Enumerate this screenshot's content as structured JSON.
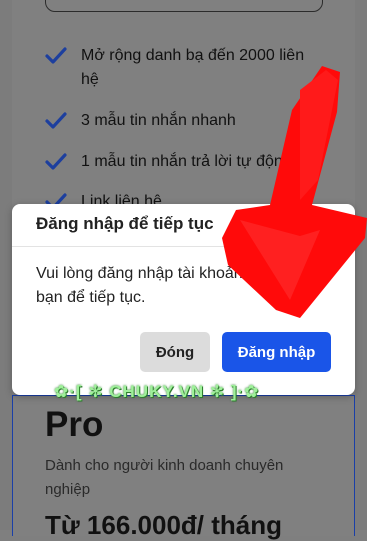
{
  "features": [
    {
      "label": "Mở rộng danh bạ đến 2000 liên hệ"
    },
    {
      "label": "3 mẫu tin nhắn nhanh"
    },
    {
      "label": "1 mẫu tin nhắn trả lời tự động"
    },
    {
      "label": "Link liên hệ"
    }
  ],
  "plan": {
    "name": "Pro",
    "description": "Dành cho người kinh doanh chuyên nghiệp",
    "price": "Từ 166.000đ/ tháng"
  },
  "modal": {
    "title": "Đăng nhập để tiếp tục",
    "message": "Vui lòng đăng nhập tài khoản Zalo bạn để tiếp tục.",
    "close_label": "Đóng",
    "login_label": "Đăng nhập"
  },
  "watermark": "✿·[ ✻ CHUKY.VN ✻ ]·✿",
  "colors": {
    "accent": "#1a55e8",
    "check": "#1d4ed8",
    "arrow": "#ff0000"
  }
}
